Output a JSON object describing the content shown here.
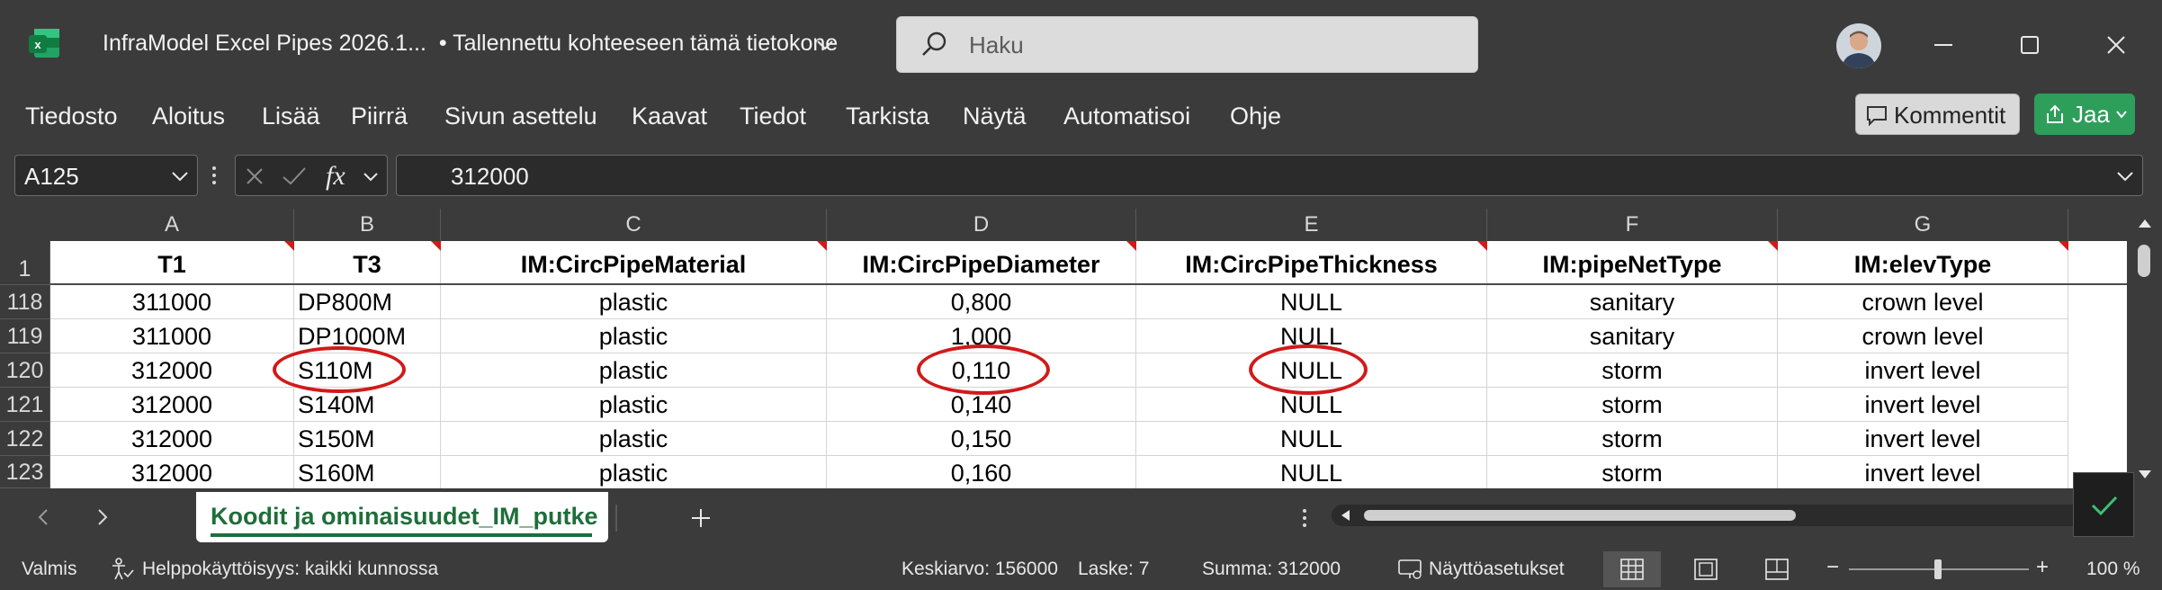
{
  "window": {
    "title": "InfraModel Excel Pipes 2026.1...",
    "save_status": "• Tallennettu kohteeseen tämä tietokone",
    "search_placeholder": "Haku"
  },
  "menu": {
    "items": [
      "Tiedosto",
      "Aloitus",
      "Lisää",
      "Piirrä",
      "Sivun asettelu",
      "Kaavat",
      "Tiedot",
      "Tarkista",
      "Näytä",
      "Automatisoi",
      "Ohje"
    ],
    "comments_label": "Kommentit",
    "share_label": "Jaa"
  },
  "formula_bar": {
    "name_box": "A125",
    "formula": "312000",
    "fx_label": "fx"
  },
  "columns": [
    "A",
    "B",
    "C",
    "D",
    "E",
    "F",
    "G"
  ],
  "header_row": {
    "row_number": "1",
    "cells": [
      "T1",
      "T3",
      "IM:CircPipeMaterial",
      "IM:CircPipeDiameter",
      "IM:CircPipeThickness",
      "IM:pipeNetType",
      "IM:elevType"
    ]
  },
  "rows": [
    {
      "row_number": "118",
      "cells": [
        "311000",
        "DP800M",
        "plastic",
        "0,800",
        "NULL",
        "sanitary",
        "crown level"
      ]
    },
    {
      "row_number": "119",
      "cells": [
        "311000",
        "DP1000M",
        "plastic",
        "1,000",
        "NULL",
        "sanitary",
        "crown level"
      ]
    },
    {
      "row_number": "120",
      "cells": [
        "312000",
        "S110M",
        "plastic",
        "0,110",
        "NULL",
        "storm",
        "invert level"
      ]
    },
    {
      "row_number": "121",
      "cells": [
        "312000",
        "S140M",
        "plastic",
        "0,140",
        "NULL",
        "storm",
        "invert level"
      ]
    },
    {
      "row_number": "122",
      "cells": [
        "312000",
        "S150M",
        "plastic",
        "0,150",
        "NULL",
        "storm",
        "invert level"
      ]
    },
    {
      "row_number": "123",
      "cells": [
        "312000",
        "S160M",
        "plastic",
        "0,160",
        "NULL",
        "storm",
        "invert level"
      ]
    }
  ],
  "sheet_tab": {
    "label": "Koodit ja ominaisuudet_IM_putke"
  },
  "status": {
    "ready": "Valmis",
    "accessibility": "Helppokäyttöisyys: kaikki kunnossa",
    "average": "Keskiarvo: 156000",
    "count": "Laske: 7",
    "sum": "Summa: 312000",
    "display_settings": "Näyttöasetukset",
    "zoom": "100 %"
  },
  "colors": {
    "accent_green": "#2e9e5b",
    "annotation_red": "#d11a1a",
    "tab_green": "#1f6e3a"
  }
}
